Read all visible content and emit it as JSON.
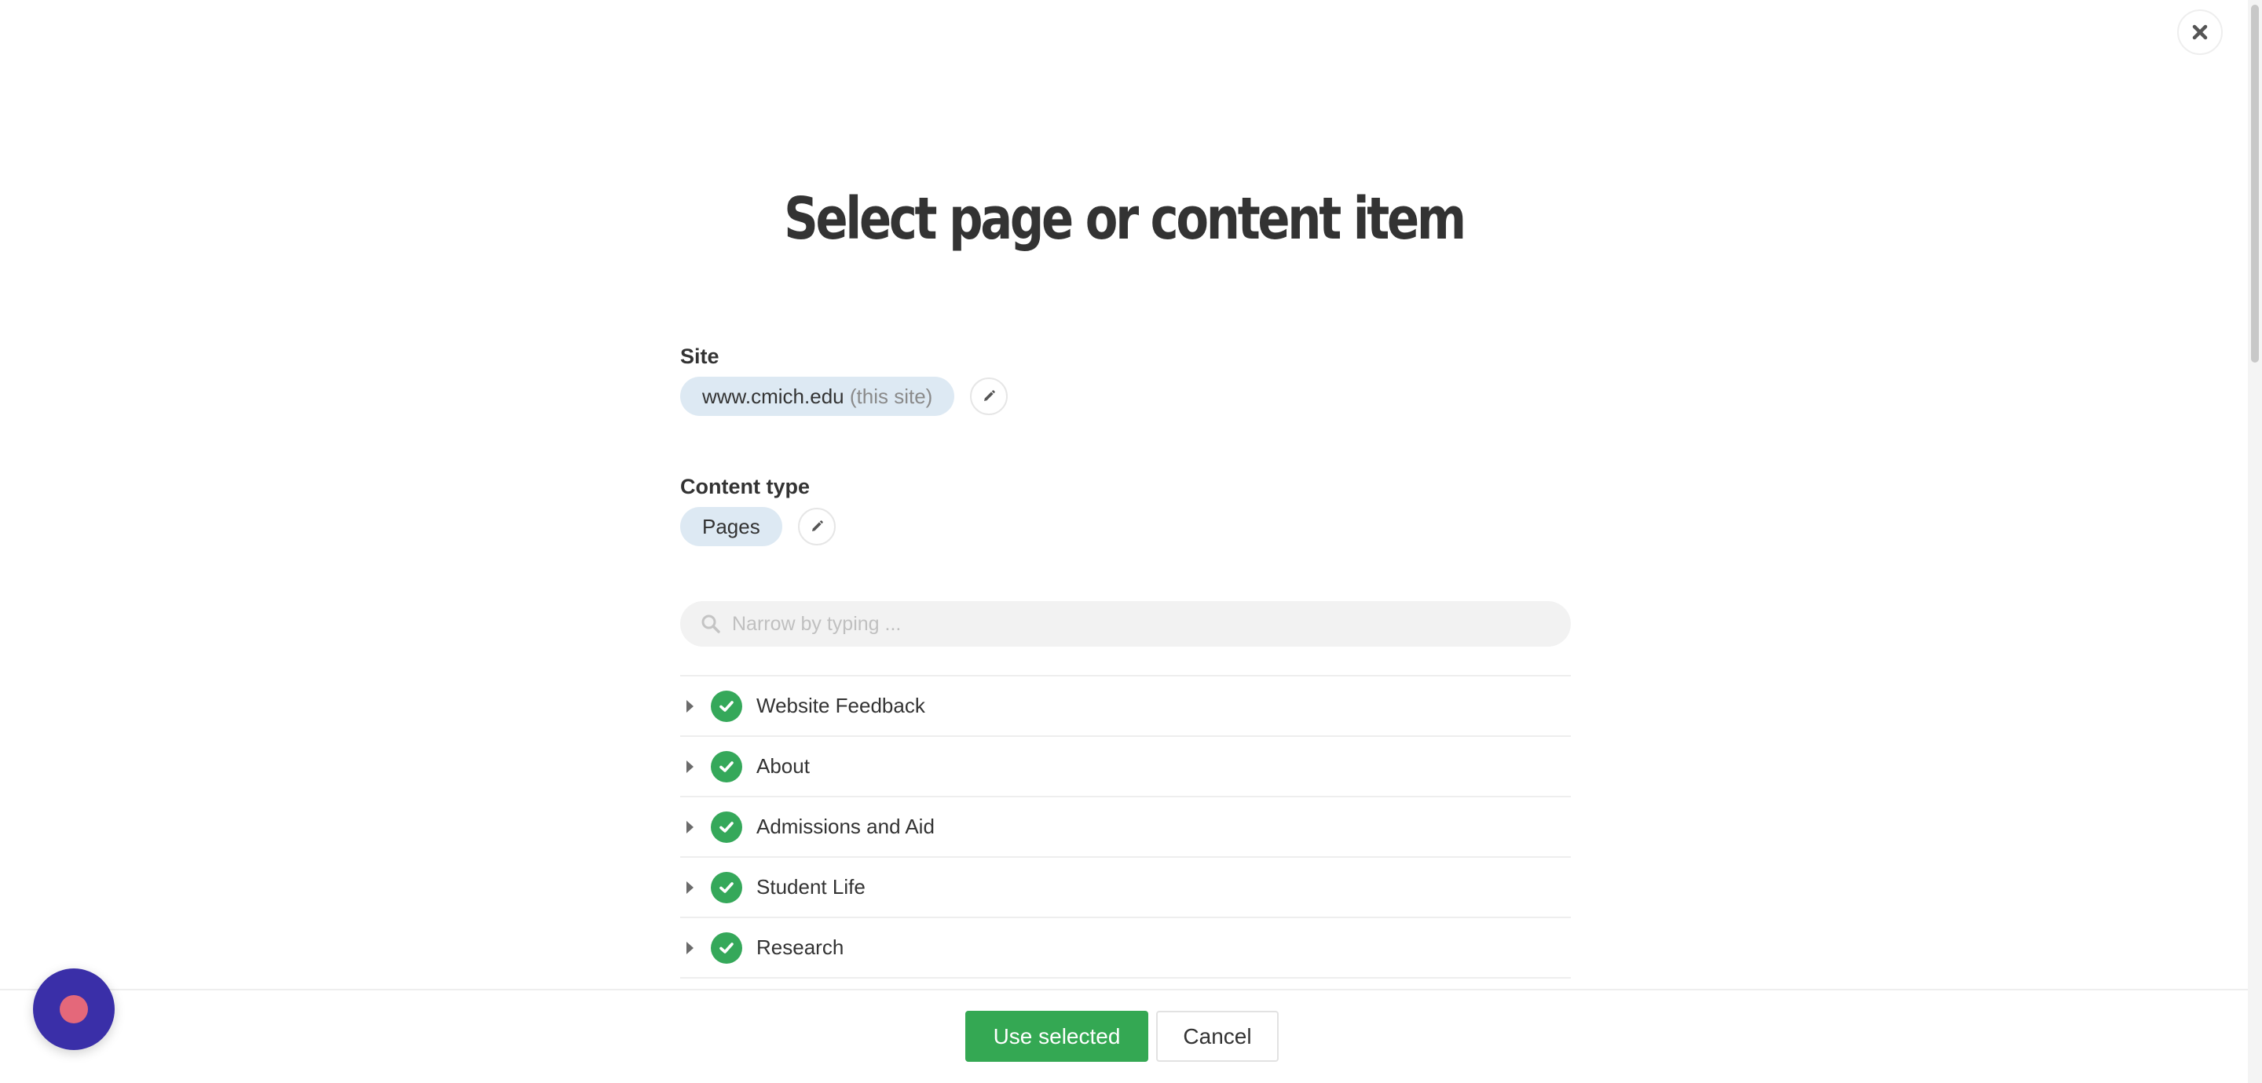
{
  "dialog": {
    "title": "Select page or content item",
    "close_icon": "close-icon"
  },
  "site": {
    "label": "Site",
    "value": "www.cmich.edu",
    "note": "(this site)",
    "edit_icon": "pencil-icon"
  },
  "content_type": {
    "label": "Content type",
    "value": "Pages",
    "edit_icon": "pencil-icon"
  },
  "search": {
    "placeholder": "Narrow by typing ...",
    "value": "",
    "icon": "search-icon"
  },
  "tree": {
    "items": [
      {
        "label": "Website Feedback",
        "expand_icon": "caret-right-icon",
        "status_icon": "check-circle-icon"
      },
      {
        "label": "About",
        "expand_icon": "caret-right-icon",
        "status_icon": "check-circle-icon"
      },
      {
        "label": "Admissions and Aid",
        "expand_icon": "caret-right-icon",
        "status_icon": "check-circle-icon"
      },
      {
        "label": "Student Life",
        "expand_icon": "caret-right-icon",
        "status_icon": "check-circle-icon"
      },
      {
        "label": "Research",
        "expand_icon": "caret-right-icon",
        "status_icon": "check-circle-icon"
      }
    ]
  },
  "footer": {
    "use_selected_label": "Use selected",
    "cancel_label": "Cancel"
  },
  "colors": {
    "accent_green": "#34a853",
    "chip_background": "#dde9f3",
    "help_bubble": "#3a2fa8",
    "help_dot": "#e4687a"
  }
}
